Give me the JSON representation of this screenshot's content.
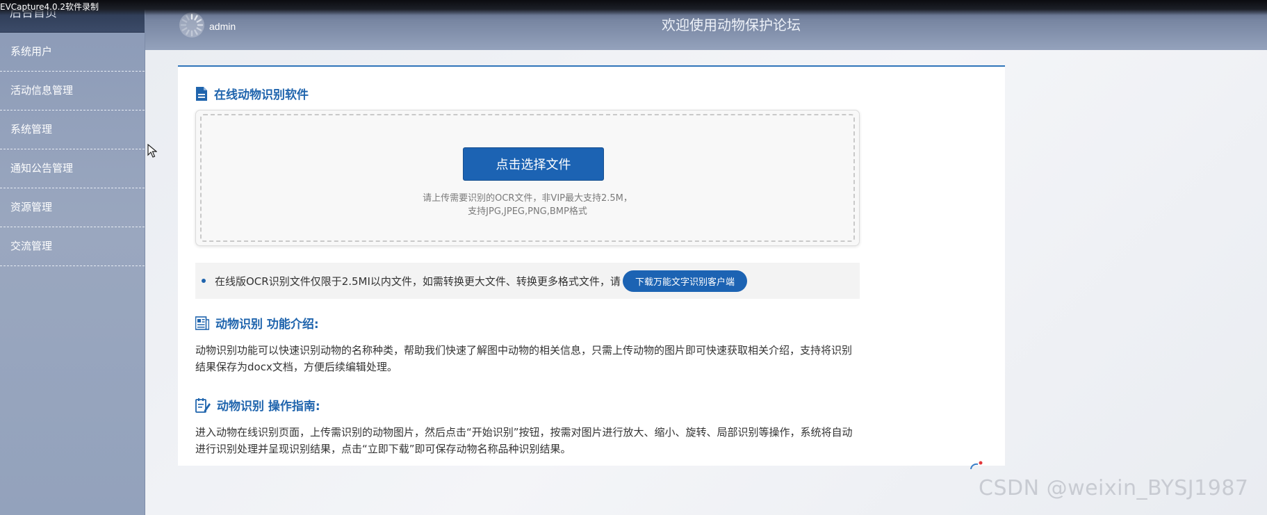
{
  "capture": {
    "text": "EVCapture4.0.2软件录制"
  },
  "sidebar": {
    "home_label": "后台首页",
    "items": [
      {
        "label": "系统用户"
      },
      {
        "label": "活动信息管理"
      },
      {
        "label": "系统管理"
      },
      {
        "label": "通知公告管理"
      },
      {
        "label": "资源管理"
      },
      {
        "label": "交流管理"
      }
    ]
  },
  "header": {
    "username": "admin",
    "welcome": "欢迎使用动物保护论坛"
  },
  "content": {
    "section1_title": "在线动物识别软件",
    "upload": {
      "button_label": "点击选择文件",
      "hint_line1": "请上传需要识别的OCR文件，非VIP最大支持2.5M，",
      "hint_line2": "支持JPG,JPEG,PNG,BMP格式"
    },
    "notice": {
      "text": "在线版OCR识别文件仅限于2.5MI以内文件，如需转换更大文件、转换更多格式文件，请",
      "download_label": "下载万能文字识别客户端"
    },
    "section2_title": "动物识别 功能介绍:",
    "section2_text": "动物识别功能可以快速识别动物的名称种类，帮助我们快速了解图中动物的相关信息，只需上传动物的图片即可快速获取相关介绍，支持将识别结果保存为docx文档，方便后续编辑处理。",
    "section3_title": "动物识别 操作指南:",
    "section3_text": "进入动物在线识别页面，上传需识别的动物图片，然后点击“开始识别”按钮，按需对图片进行放大、缩小、旋转、局部识别等操作，系统将自动进行识别处理并呈现识别结果，点击“立即下载”即可保存动物名称品种识别结果。"
  },
  "watermark": {
    "text": "CSDN @weixin_BYSJ1987"
  },
  "colors": {
    "accent": "#1c63b3",
    "title": "#1f64ad",
    "sidebar": "#93a2bc"
  }
}
